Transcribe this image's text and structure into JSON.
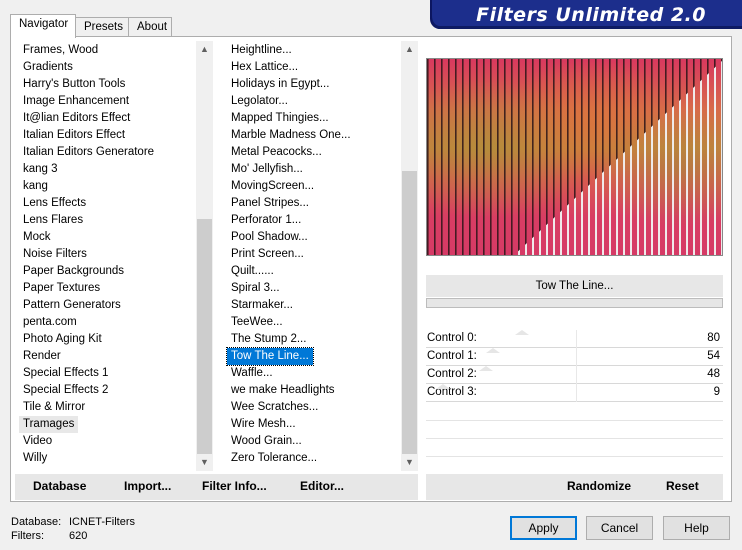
{
  "banner": {
    "title": "Filters Unlimited 2.0",
    "color": "#1c2e8c"
  },
  "tabs": [
    {
      "label": "Navigator",
      "active": true
    },
    {
      "label": "Presets",
      "active": false
    },
    {
      "label": "About",
      "active": false
    }
  ],
  "categories": {
    "items": [
      "Frames, Wood",
      "Gradients",
      "Harry's Button Tools",
      "Image Enhancement",
      "It@lian Editors Effect",
      "Italian Editors Effect",
      "Italian Editors Generatore",
      "kang 3",
      "kang",
      "Lens Effects",
      "Lens Flares",
      "Mock",
      "Noise Filters",
      "Paper Backgrounds",
      "Paper Textures",
      "Pattern Generators",
      "penta.com",
      "Photo Aging Kit",
      "Render",
      "Special Effects 1",
      "Special Effects 2",
      "Tile & Mirror",
      "Tramages",
      "Video",
      "Willy"
    ],
    "selected": "Tramages"
  },
  "filters": {
    "items": [
      "Heightline...",
      "Hex Lattice...",
      "Holidays in Egypt...",
      "Legolator...",
      "Mapped Thingies...",
      "Marble Madness One...",
      "Metal Peacocks...",
      "Mo' Jellyfish...",
      "MovingScreen...",
      "Panel Stripes...",
      "Perforator 1...",
      "Pool Shadow...",
      "Print Screen...",
      "Quilt......",
      "Spiral 3...",
      "Starmaker...",
      "TeeWee...",
      "The Stump 2...",
      "Tow The Line...",
      "Waffle...",
      "we make Headlights",
      "Wee Scratches...",
      "Wire Mesh...",
      "Wood Grain...",
      "Zero Tolerance..."
    ],
    "selected": "Tow The Line..."
  },
  "filter_name": "Tow The Line...",
  "controls": [
    {
      "label": "Control 0:",
      "value": "80",
      "level": 80
    },
    {
      "label": "Control 1:",
      "value": "54",
      "level": 54
    },
    {
      "label": "Control 2:",
      "value": "48",
      "level": 48
    },
    {
      "label": "Control 3:",
      "value": "9",
      "level": 9
    }
  ],
  "toolbar": {
    "database": "Database",
    "import": "Import...",
    "filter_info": "Filter Info...",
    "editor": "Editor...",
    "randomize": "Randomize",
    "reset": "Reset"
  },
  "status": {
    "database_label": "Database:",
    "database_value": "ICNET-Filters",
    "filters_label": "Filters:",
    "filters_value": "620"
  },
  "buttons": {
    "apply": "Apply",
    "cancel": "Cancel",
    "help": "Help"
  },
  "icons": {
    "scroll_up": "chevron-up-icon",
    "scroll_down": "chevron-down-icon"
  }
}
